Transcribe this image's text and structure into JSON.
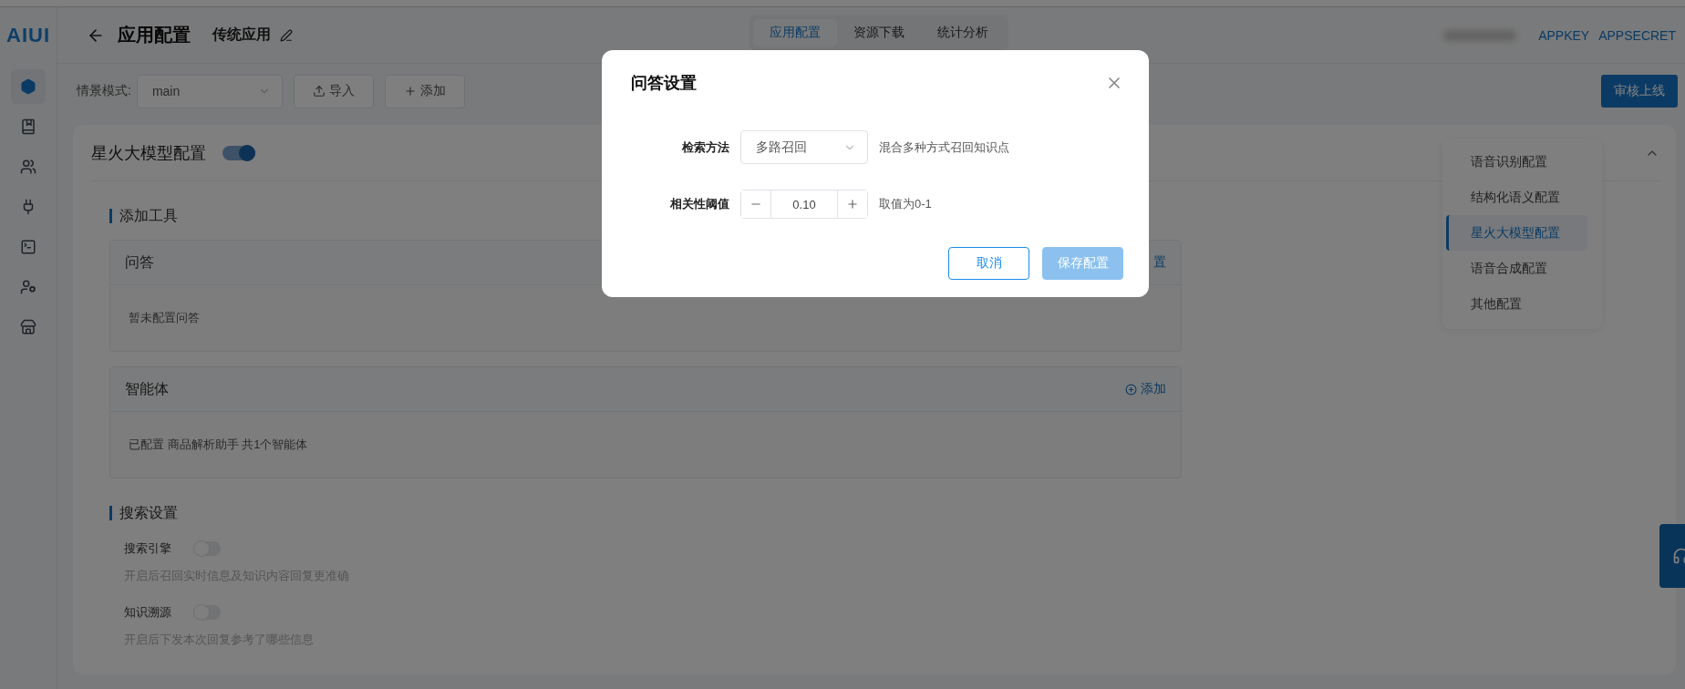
{
  "logo": {
    "text": "AIUI"
  },
  "sidebar": {
    "items": [
      {
        "kind": "hexagon",
        "selected": true
      },
      {
        "kind": "bookmark",
        "selected": false
      },
      {
        "kind": "people",
        "selected": false
      },
      {
        "kind": "plug",
        "selected": false
      },
      {
        "kind": "terminal",
        "selected": false
      },
      {
        "kind": "user",
        "selected": false
      },
      {
        "kind": "store",
        "selected": false
      }
    ]
  },
  "header": {
    "title": "应用配置",
    "app_name": "传统应用",
    "tabs": [
      {
        "label": "应用配置",
        "selected": true
      },
      {
        "label": "资源下载",
        "selected": false
      },
      {
        "label": "统计分析",
        "selected": false
      }
    ],
    "links": [
      "APPKEY",
      "APPSECRET"
    ]
  },
  "toolbar": {
    "scene_label": "情景模式:",
    "scene_value": "main",
    "buttons": [
      {
        "kind": "import",
        "label": "导入"
      },
      {
        "kind": "add",
        "label": "添加"
      }
    ],
    "publish": "审核上线"
  },
  "section": {
    "title": "星火大模型配置",
    "on": true,
    "tools_title": "添加工具",
    "tools": [
      {
        "title": "问答",
        "action": {
          "kind": "link",
          "label": "置"
        },
        "body": "暂未配置问答"
      },
      {
        "title": "智能体",
        "action": {
          "kind": "add",
          "label": "添加"
        },
        "body": "已配置 商品解析助手 共1个智能体"
      }
    ],
    "search_title": "搜索设置",
    "search": [
      {
        "label": "搜索引擎",
        "on": false,
        "description": "开启后召回实时信息及知识内容回复更准确"
      },
      {
        "label": "知识溯源",
        "on": false,
        "description": "开启后下发本次回复参考了哪些信息"
      }
    ]
  },
  "nav": {
    "items": [
      {
        "label": "语音识别配置",
        "selected": false
      },
      {
        "label": "结构化语义配置",
        "selected": false
      },
      {
        "label": "星火大模型配置",
        "selected": true
      },
      {
        "label": "语音合成配置",
        "selected": false
      },
      {
        "label": "其他配置",
        "selected": false
      }
    ]
  },
  "modal": {
    "title": "问答设置",
    "fields": [
      {
        "kind": "select",
        "label": "检索方法",
        "value": "多路召回",
        "hint": "混合多种方式召回知识点"
      },
      {
        "kind": "stepper",
        "label": "相关性阈值",
        "value": "0.10",
        "hint": "取值为0-1"
      }
    ],
    "buttons": [
      {
        "kind": "secondary",
        "label": "取消",
        "disabled": false
      },
      {
        "kind": "primary",
        "label": "保存配置",
        "disabled": true
      }
    ]
  }
}
